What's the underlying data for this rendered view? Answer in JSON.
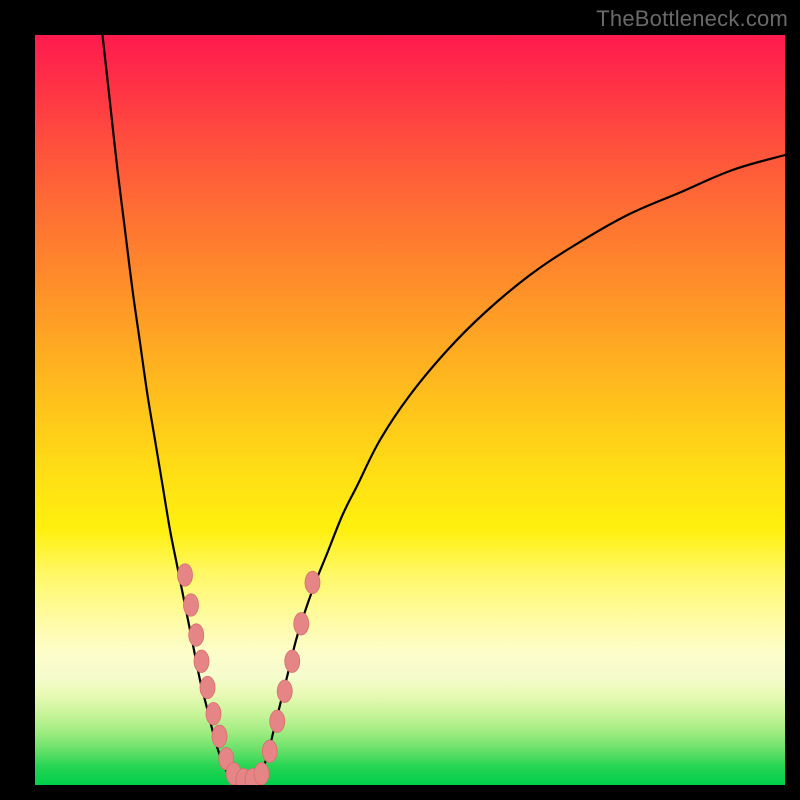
{
  "watermark": "TheBottleneck.com",
  "chart_data": {
    "type": "line",
    "title": "",
    "xlabel": "",
    "ylabel": "",
    "xlim": [
      0,
      100
    ],
    "ylim": [
      0,
      100
    ],
    "gradient_stops": [
      {
        "pct": 0,
        "color": "#ff1b4e"
      },
      {
        "pct": 50,
        "color": "#ffc81a"
      },
      {
        "pct": 75,
        "color": "#fffb9a"
      },
      {
        "pct": 92,
        "color": "#9eec80"
      },
      {
        "pct": 100,
        "color": "#00cf4b"
      }
    ],
    "series": [
      {
        "name": "left_branch",
        "x": [
          9,
          10,
          11,
          12,
          13,
          14,
          15,
          16,
          17,
          18,
          19,
          20,
          21,
          22,
          23,
          24,
          25,
          26
        ],
        "y": [
          100,
          91,
          82,
          74,
          66,
          59,
          52,
          46,
          40,
          34,
          29,
          24,
          19,
          14,
          10,
          6,
          3,
          1
        ]
      },
      {
        "name": "right_branch",
        "x": [
          30,
          31,
          32,
          33,
          34,
          35,
          37,
          39,
          41,
          43,
          46,
          50,
          55,
          60,
          66,
          72,
          79,
          86,
          93,
          100
        ],
        "y": [
          1,
          4,
          8,
          12,
          16,
          20,
          26,
          31,
          36,
          40,
          46,
          52,
          58,
          63,
          68,
          72,
          76,
          79,
          82,
          84
        ]
      },
      {
        "name": "valley_floor",
        "x": [
          26,
          27,
          28,
          29,
          30
        ],
        "y": [
          1,
          0.5,
          0.4,
          0.5,
          1
        ]
      }
    ],
    "markers": [
      {
        "x": 20.0,
        "y": 28.0
      },
      {
        "x": 20.8,
        "y": 24.0
      },
      {
        "x": 21.5,
        "y": 20.0
      },
      {
        "x": 22.2,
        "y": 16.5
      },
      {
        "x": 23.0,
        "y": 13.0
      },
      {
        "x": 23.8,
        "y": 9.5
      },
      {
        "x": 24.6,
        "y": 6.5
      },
      {
        "x": 25.5,
        "y": 3.5
      },
      {
        "x": 26.5,
        "y": 1.5
      },
      {
        "x": 27.8,
        "y": 0.7
      },
      {
        "x": 29.0,
        "y": 0.7
      },
      {
        "x": 30.2,
        "y": 1.5
      },
      {
        "x": 31.3,
        "y": 4.5
      },
      {
        "x": 32.3,
        "y": 8.5
      },
      {
        "x": 33.3,
        "y": 12.5
      },
      {
        "x": 34.3,
        "y": 16.5
      },
      {
        "x": 35.5,
        "y": 21.5
      },
      {
        "x": 37.0,
        "y": 27.0
      }
    ],
    "marker_rx": 1.0,
    "marker_ry": 1.5
  }
}
